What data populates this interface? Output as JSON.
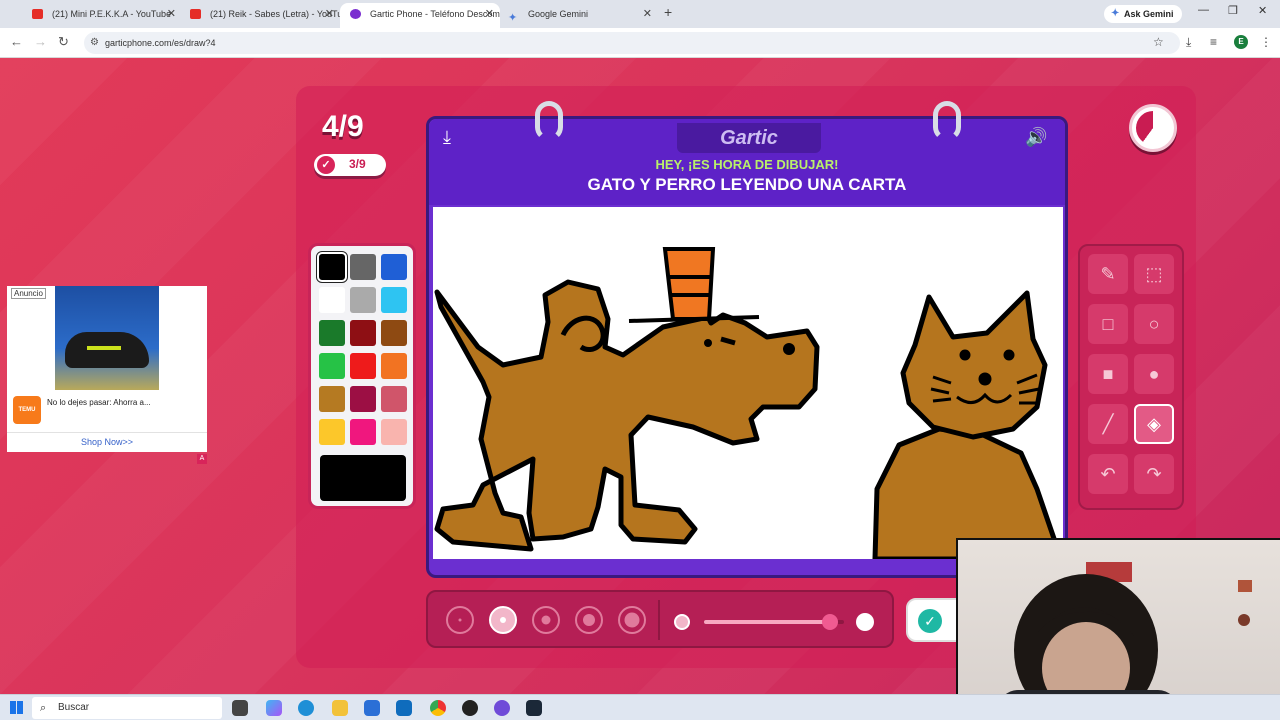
{
  "browser": {
    "tabs": [
      {
        "label": "(21) Mini P.E.K.K.A - YouTube",
        "icon": "youtube-icon",
        "color": "#e52d27"
      },
      {
        "label": "(21) Reik - Sabes (Letra) - YouTube",
        "icon": "youtube-icon",
        "color": "#e52d27"
      },
      {
        "label": "Gartic Phone - Teléfono Descom",
        "icon": "gartic-icon",
        "color": "#7b2fd0"
      },
      {
        "label": "Google Gemini",
        "icon": "gemini-icon",
        "color": "#4a7bd9"
      }
    ],
    "ask_gemini": "Ask Gemini",
    "url": "garticphone.com/es/draw?4",
    "profile_initial": "E"
  },
  "game": {
    "round": "4/9",
    "progress": "3/9",
    "timer_remaining_fraction": 0.4,
    "logo": "Gartic",
    "header_hint": "HEY, ¡ES HORA DE DIBUJAR!",
    "prompt": "GATO Y PERRO LEYENDO UNA CARTA",
    "palette": [
      "#000000",
      "#666666",
      "#1f5fd6",
      "#ffffff",
      "#aaaaaa",
      "#2ec4f2",
      "#1a7a2a",
      "#8e0f14",
      "#8e4a12",
      "#26c246",
      "#ee1b1b",
      "#f27322",
      "#b57a22",
      "#9c0f44",
      "#d0556a",
      "#fcc72a",
      "#f0177e",
      "#f9b4ae"
    ],
    "selected_color": "#000000",
    "tools": [
      "pencil-icon",
      "eraser-icon",
      "rectangle-outline-icon",
      "ellipse-outline-icon",
      "rectangle-filled-icon",
      "ellipse-filled-icon",
      "line-icon",
      "fill-bucket-icon",
      "undo-icon",
      "redo-icon"
    ],
    "selected_tool": "fill-bucket-icon",
    "brush_sizes": 5,
    "selected_brush_size": 2,
    "opacity_fraction": 0.9
  },
  "ad": {
    "tag": "Anuncio",
    "brand": "TEMU",
    "text": "No lo dejes pasar: Ahorra a...",
    "cta": "Shop Now>>",
    "badge": "A"
  },
  "taskbar": {
    "search_placeholder": "Buscar"
  }
}
